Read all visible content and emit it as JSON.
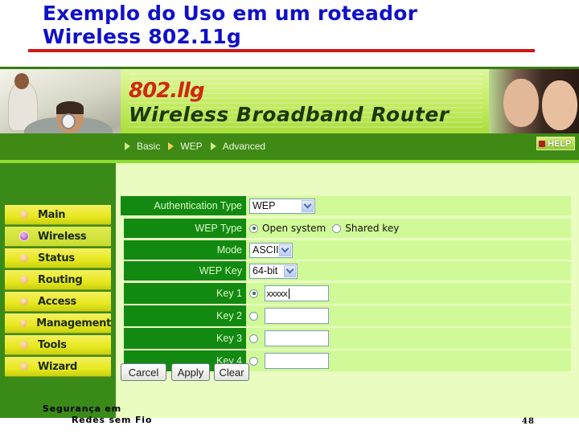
{
  "slide": {
    "title_line1": "Exemplo do Uso em um roteador",
    "title_line2": "Wireless 802.11g",
    "footer_line1": "Segurança em",
    "footer_line2": "Redes sem Fio",
    "page_number": "48",
    "colors": {
      "title": "#1010c8",
      "rule": "#d01818"
    }
  },
  "router": {
    "logo_model": "802.llg",
    "logo_product": "Wireless Broadband Router",
    "breadcrumb": [
      {
        "label": "Basic",
        "active": false
      },
      {
        "label": "WEP",
        "active": true
      },
      {
        "label": "Advanced",
        "active": false
      }
    ],
    "help_label": "HELP",
    "sidebar": {
      "items": [
        {
          "label": "Main",
          "active": false
        },
        {
          "label": "Wireless",
          "active": true
        },
        {
          "label": "Status",
          "active": false
        },
        {
          "label": "Routing",
          "active": false
        },
        {
          "label": "Access",
          "active": false
        },
        {
          "label": "Management",
          "active": false
        },
        {
          "label": "Tools",
          "active": false
        },
        {
          "label": "Wizard",
          "active": false
        }
      ]
    },
    "form": {
      "auth_type_label": "Authentication Type",
      "auth_type_value": "WEP",
      "wep_type_label": "WEP Type",
      "wep_type_options": [
        "Open system",
        "Shared key"
      ],
      "wep_type_selected": "Open system",
      "mode_label": "Mode",
      "mode_value": "ASCII",
      "wep_key_label": "WEP Key",
      "wep_key_value": "64-bit",
      "keys": [
        {
          "label": "Key 1",
          "selected": true,
          "value": "xxxxx"
        },
        {
          "label": "Key 2",
          "selected": false,
          "value": ""
        },
        {
          "label": "Key 3",
          "selected": false,
          "value": ""
        },
        {
          "label": "Key 4",
          "selected": false,
          "value": ""
        }
      ]
    },
    "buttons": {
      "cancel": "Carcel",
      "apply": "Apply",
      "clear": "Clear"
    },
    "colors": {
      "label_bg": "#128a12",
      "row_bg": "#d0fa98",
      "content_bg": "#eafcc0",
      "sidebar_bg": "#3a8a18",
      "menu_bg": "#e8e820"
    }
  }
}
